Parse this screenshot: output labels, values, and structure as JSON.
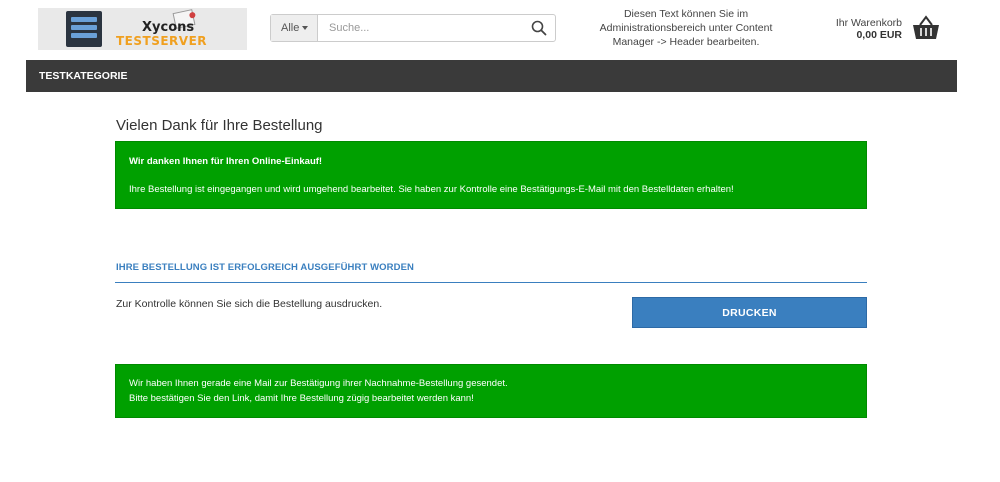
{
  "header": {
    "logo": {
      "brand_line1": "Xycons",
      "brand_line2": "TESTSERVER"
    },
    "search": {
      "category_label": "Alle",
      "placeholder": "Suche..."
    },
    "info_text": "Diesen Text können Sie im Administrationsbereich unter Content Manager -> Header bearbeiten.",
    "cart": {
      "label": "Ihr Warenkorb",
      "total": "0,00 EUR"
    }
  },
  "nav": {
    "items": [
      {
        "label": "TESTKATEGORIE"
      }
    ]
  },
  "main": {
    "title": "Vielen Dank für Ihre Bestellung",
    "alert1": {
      "line1": "Wir danken Ihnen für Ihren Online-Einkauf!",
      "line2": "Ihre Bestellung ist eingegangen und wird umgehend bearbeitet. Sie haben zur Kontrolle eine Bestätigungs-E-Mail mit den Bestelldaten erhalten!"
    },
    "section": {
      "heading": "IHRE BESTELLUNG IST ERFOLGREICH AUSGEFÜHRT WORDEN",
      "text": "Zur Kontrolle können Sie sich die Bestellung ausdrucken.",
      "print_button": "DRUCKEN"
    },
    "alert2": {
      "line1": "Wir haben Ihnen gerade eine Mail zur Bestätigung ihrer Nachnahme-Bestellung gesendet.",
      "line2": "Bitte bestätigen Sie den Link, damit Ihre Bestellung zügig bearbeitet werden kann!"
    }
  },
  "colors": {
    "alert_green": "#00a000",
    "accent_blue": "#3a7fbf",
    "nav_bg": "#3a3a3a"
  },
  "icons": {
    "search": "search-icon",
    "cart": "basket-icon"
  }
}
